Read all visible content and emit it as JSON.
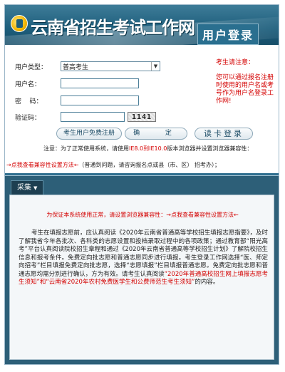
{
  "header": {
    "site_title": "云南省招生考试工作网",
    "login_title": "用户登录"
  },
  "form": {
    "user_type_label": "用户类型：",
    "user_type_value": "普高考生",
    "username_label": "用户名：",
    "username_value": "",
    "password_label": "密    码：",
    "password_value": "",
    "captcha_label": "验证码：",
    "captcha_value": "",
    "captcha_image_text": "1141"
  },
  "notice": {
    "title": "考生请注意：",
    "body": "您可以通过报名注册时使用的用户名或考号作为用户名登录工作网!"
  },
  "buttons": {
    "register": "考生用户免费注册",
    "confirm": "确  定",
    "read_card": "读卡登录"
  },
  "notes": {
    "browser_pre": "注意：为了正常使用系统，请使用",
    "browser_ie": "IE8.0到IE10.0",
    "browser_post": "版本浏览器并设置浏览器兼容性：",
    "compat_link": "→点我查看兼容性设置方法←",
    "compat_hint": "（普通到问题，请咨询报名点或县（市、区） 招考办）；"
  },
  "panel": {
    "tab_label": "采集",
    "warning": "为保证本系统使用正常，请设置浏览器兼容性：→点我查看兼容性设置方法←",
    "text_a": "考生在填报志愿前，应认真阅读《2020年云南省普通高等学校招生填报志愿指要》，及时了解我省今年各批次、各科类的志愿设置和投档录取过程中的各项政策；通过教育部“阳光高考”平台认真阅读院校招生章程和通过《2020年云南省普通高等学校招生计划》了解院校招生信息和报考条件。免费定向批志愿和普通志愿同步进行填报。考生登录工作网选择“医、师定向招考”栏目填报免费定向批志愿，选择“志愿填报”栏目填报普通志愿。免费定向批志愿和普通志愿均需分别进行确认，方为有效。请考生认真阅读",
    "text_red": "“2020年普通高校招生网上填报志愿考生须知”和“云南省2020年农村免费医学生和公费师范生考生须知”",
    "text_b": "的内容。"
  }
}
